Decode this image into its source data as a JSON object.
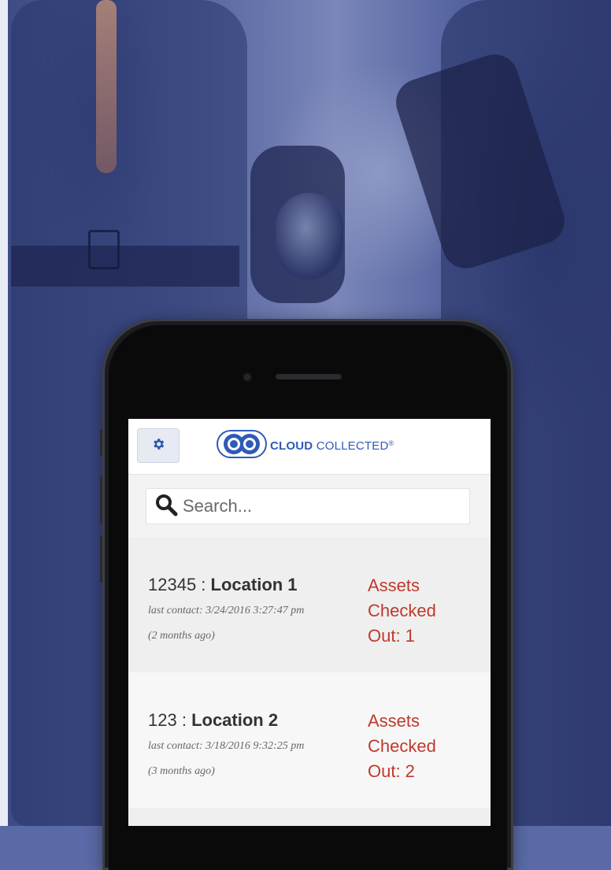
{
  "app": {
    "brand_bold": "CLOUD",
    "brand_rest": " COLLECTED",
    "brand_mark": "®"
  },
  "toolbar": {
    "settings_icon": "gear-icon"
  },
  "search": {
    "placeholder": "Search...",
    "icon": "search-icon"
  },
  "locations": [
    {
      "id": "12345",
      "separator": " : ",
      "name": "Location 1",
      "last_contact": "last contact: 3/24/2016 3:27:47 pm",
      "ago": "(2 months ago)",
      "status_line1": "Assets",
      "status_line2": "Checked",
      "status_line3": "Out: 1"
    },
    {
      "id": "123",
      "separator": " : ",
      "name": "Location 2",
      "last_contact": "last contact: 3/18/2016 9:32:25 pm",
      "ago": "(3 months ago)",
      "status_line1": "Assets",
      "status_line2": "Checked",
      "status_line3": "Out: 2"
    }
  ],
  "colors": {
    "accent": "#2f5bb7",
    "status": "#c0392b"
  }
}
